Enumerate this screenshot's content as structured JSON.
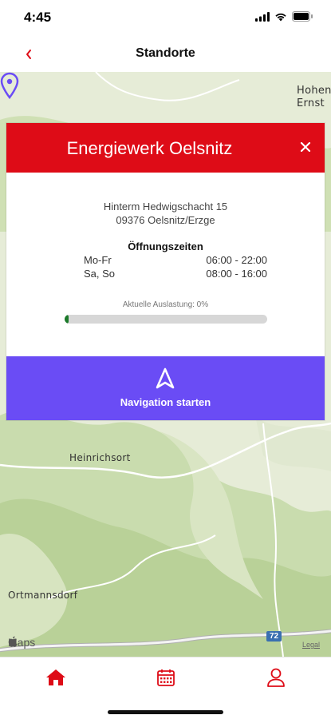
{
  "status": {
    "time": "4:45"
  },
  "nav": {
    "title": "Standorte"
  },
  "map": {
    "labels": {
      "heinrichsort": "Heinrichsort",
      "ortmannsdorf": "Ortmannsdorf",
      "hohen_ernst_1": "Hohen",
      "hohen_ernst_2": "Ernst"
    },
    "brand": "Maps",
    "legal": "Legal",
    "road_badge": "72"
  },
  "modal": {
    "title": "Energiewerk Oelsnitz",
    "address_line1": "Hinterm Hedwigschacht 15",
    "address_line2": "09376 Oelsnitz/Erzge",
    "hours_title": "Öffnungszeiten",
    "hours": [
      {
        "days": "Mo-Fr",
        "time": "06:00 - 22:00"
      },
      {
        "days": "Sa, So",
        "time": "08:00 - 16:00"
      }
    ],
    "load_label": "Aktuelle Auslastung: 0%",
    "load_fraction": 0.02,
    "navigate_label": "Navigation starten"
  },
  "colors": {
    "accent_red": "#de0c17",
    "navigate_purple": "#6a4cf5",
    "load_green": "#1b7a2a"
  },
  "tabs": [
    "home-icon",
    "calendar-icon",
    "user-icon"
  ]
}
